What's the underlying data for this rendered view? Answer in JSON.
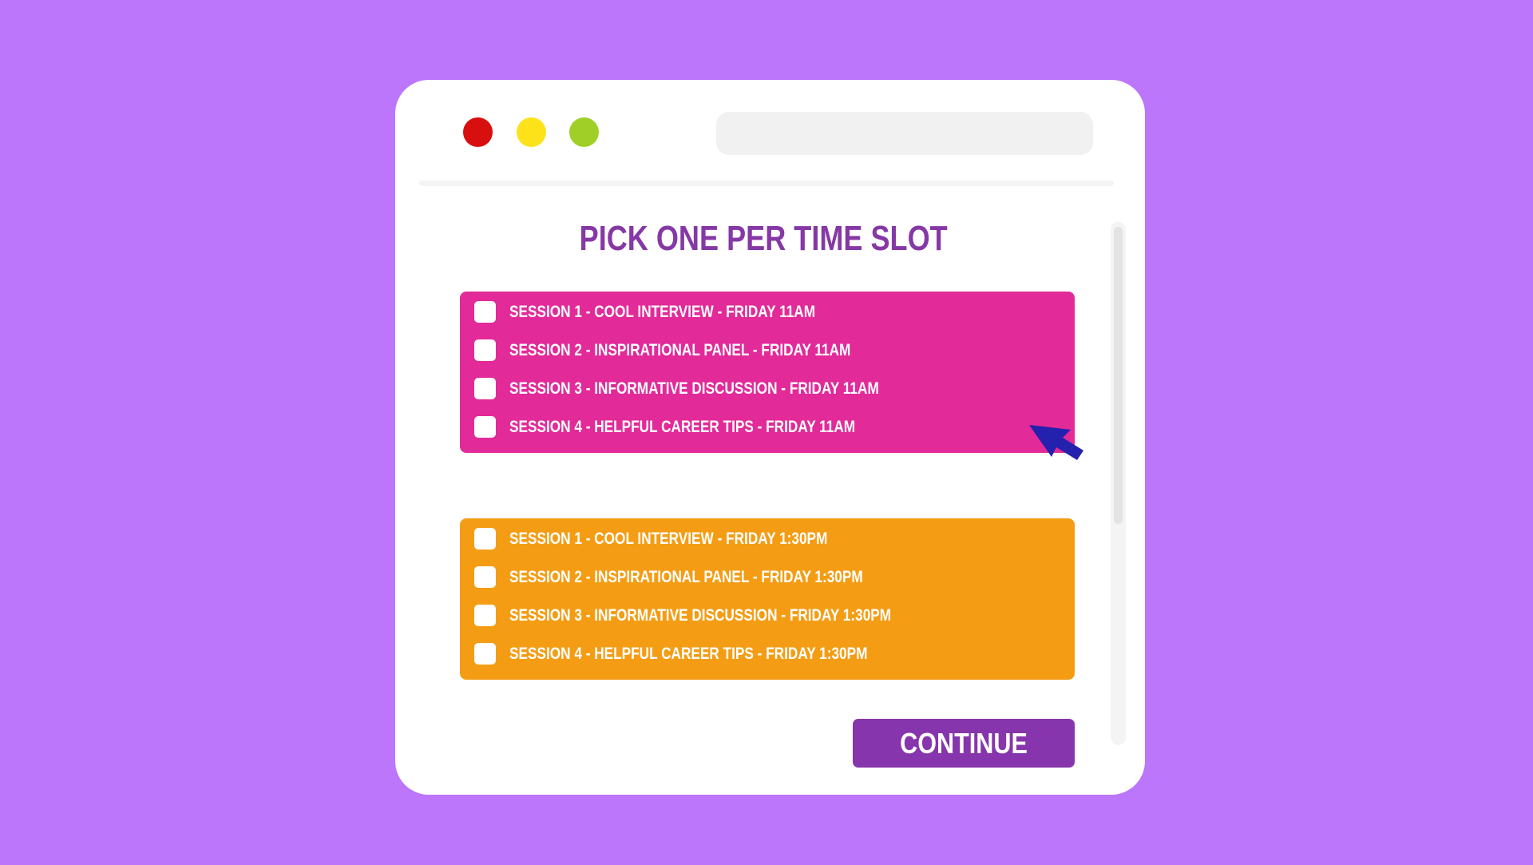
{
  "colors": {
    "background": "#bb76fb",
    "window": "#ffffff",
    "heading": "#8638a6",
    "slot_1": "#e22a99",
    "slot_2": "#f49d14",
    "button": "#8735ac",
    "cursor": "#2321ad"
  },
  "window_controls": [
    "close",
    "minimize",
    "maximize"
  ],
  "heading": "PICK ONE PER TIME SLOT",
  "time_slots": [
    {
      "options": [
        {
          "label": "SESSION 1 - COOL INTERVIEW - FRIDAY 11AM",
          "checked": false
        },
        {
          "label": "SESSION 2 - INSPIRATIONAL PANEL - FRIDAY 11AM",
          "checked": false
        },
        {
          "label": "SESSION 3 - INFORMATIVE DISCUSSION - FRIDAY 11AM",
          "checked": false
        },
        {
          "label": "SESSION 4 - HELPFUL CAREER TIPS - FRIDAY 11AM",
          "checked": false
        }
      ]
    },
    {
      "options": [
        {
          "label": "SESSION 1 - COOL INTERVIEW - FRIDAY 1:30PM",
          "checked": false
        },
        {
          "label": "SESSION 2 - INSPIRATIONAL PANEL - FRIDAY 1:30PM",
          "checked": false
        },
        {
          "label": "SESSION 3 - INFORMATIVE DISCUSSION - FRIDAY 1:30PM",
          "checked": false
        },
        {
          "label": "SESSION 4 - HELPFUL CAREER TIPS - FRIDAY 1:30PM",
          "checked": false
        }
      ]
    }
  ],
  "continue_label": "CONTINUE",
  "cursor_icon": "mouse-pointer-icon"
}
